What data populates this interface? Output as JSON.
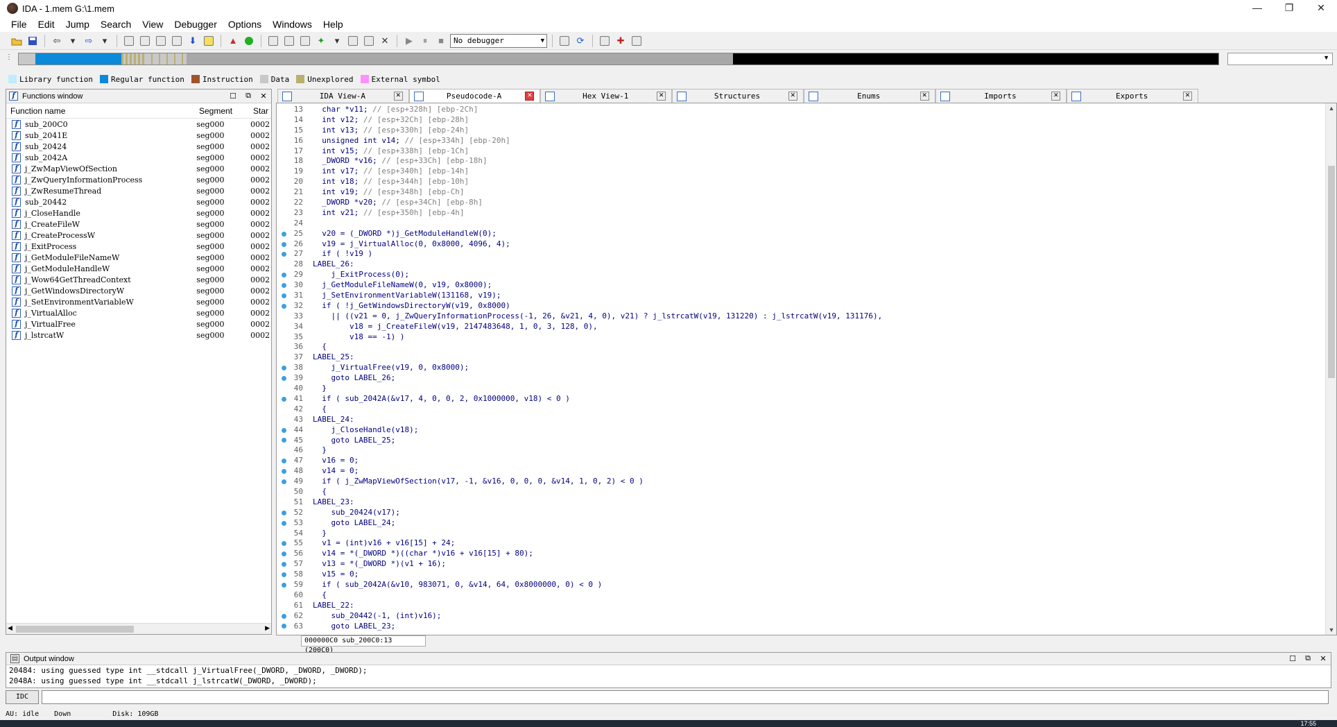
{
  "window": {
    "title": "IDA - 1.mem G:\\1.mem",
    "minimize": "—",
    "maximize": "❐",
    "close": "✕"
  },
  "menu": [
    "File",
    "Edit",
    "Jump",
    "Search",
    "View",
    "Debugger",
    "Options",
    "Windows",
    "Help"
  ],
  "toolbar": {
    "debugger_select": "No debugger"
  },
  "legend": [
    {
      "label": "Library function",
      "color": "#c0ecff"
    },
    {
      "label": "Regular function",
      "color": "#0a8ad8"
    },
    {
      "label": "Instruction",
      "color": "#a0522d"
    },
    {
      "label": "Data",
      "color": "#c8c8c8"
    },
    {
      "label": "Unexplored",
      "color": "#b8b070"
    },
    {
      "label": "External symbol",
      "color": "#ff90ff"
    }
  ],
  "functions_window": {
    "title": "Functions window",
    "columns": [
      "Function name",
      "Segment",
      "Star"
    ],
    "rows": [
      {
        "name": "sub_200C0",
        "segment": "seg000",
        "start": "0002"
      },
      {
        "name": "sub_2041E",
        "segment": "seg000",
        "start": "0002"
      },
      {
        "name": "sub_20424",
        "segment": "seg000",
        "start": "0002"
      },
      {
        "name": "sub_2042A",
        "segment": "seg000",
        "start": "0002"
      },
      {
        "name": "j_ZwMapViewOfSection",
        "segment": "seg000",
        "start": "0002"
      },
      {
        "name": "j_ZwQueryInformationProcess",
        "segment": "seg000",
        "start": "0002"
      },
      {
        "name": "j_ZwResumeThread",
        "segment": "seg000",
        "start": "0002"
      },
      {
        "name": "sub_20442",
        "segment": "seg000",
        "start": "0002"
      },
      {
        "name": "j_CloseHandle",
        "segment": "seg000",
        "start": "0002"
      },
      {
        "name": "j_CreateFileW",
        "segment": "seg000",
        "start": "0002"
      },
      {
        "name": "j_CreateProcessW",
        "segment": "seg000",
        "start": "0002"
      },
      {
        "name": "j_ExitProcess",
        "segment": "seg000",
        "start": "0002"
      },
      {
        "name": "j_GetModuleFileNameW",
        "segment": "seg000",
        "start": "0002"
      },
      {
        "name": "j_GetModuleHandleW",
        "segment": "seg000",
        "start": "0002"
      },
      {
        "name": "j_Wow64GetThreadContext",
        "segment": "seg000",
        "start": "0002"
      },
      {
        "name": "j_GetWindowsDirectoryW",
        "segment": "seg000",
        "start": "0002"
      },
      {
        "name": "j_SetEnvironmentVariableW",
        "segment": "seg000",
        "start": "0002"
      },
      {
        "name": "j_VirtualAlloc",
        "segment": "seg000",
        "start": "0002"
      },
      {
        "name": "j_VirtualFree",
        "segment": "seg000",
        "start": "0002"
      },
      {
        "name": "j_lstrcatW",
        "segment": "seg000",
        "start": "0002"
      }
    ]
  },
  "tabs": [
    {
      "label": "IDA View-A",
      "close": "✕",
      "active": false
    },
    {
      "label": "Pseudocode-A",
      "close": "✕",
      "active": true
    },
    {
      "label": "Hex View-1",
      "close": "✕",
      "active": false
    },
    {
      "label": "Structures",
      "close": "✕",
      "active": false
    },
    {
      "label": "Enums",
      "close": "✕",
      "active": false
    },
    {
      "label": "Imports",
      "close": "✕",
      "active": false
    },
    {
      "label": "Exports",
      "close": "✕",
      "active": false
    }
  ],
  "code": [
    {
      "n": "13",
      "dot": false,
      "code": "  char *v11; ",
      "comment": "// [esp+328h] [ebp-2Ch]"
    },
    {
      "n": "14",
      "dot": false,
      "code": "  int v12; ",
      "comment": "// [esp+32Ch] [ebp-28h]"
    },
    {
      "n": "15",
      "dot": false,
      "code": "  int v13; ",
      "comment": "// [esp+330h] [ebp-24h]"
    },
    {
      "n": "16",
      "dot": false,
      "code": "  unsigned int v14; ",
      "comment": "// [esp+334h] [ebp-20h]"
    },
    {
      "n": "17",
      "dot": false,
      "code": "  int v15; ",
      "comment": "// [esp+338h] [ebp-1Ch]"
    },
    {
      "n": "18",
      "dot": false,
      "code": "  _DWORD *v16; ",
      "comment": "// [esp+33Ch] [ebp-18h]"
    },
    {
      "n": "19",
      "dot": false,
      "code": "  int v17; ",
      "comment": "// [esp+340h] [ebp-14h]"
    },
    {
      "n": "20",
      "dot": false,
      "code": "  int v18; ",
      "comment": "// [esp+344h] [ebp-10h]"
    },
    {
      "n": "21",
      "dot": false,
      "code": "  int v19; ",
      "comment": "// [esp+348h] [ebp-Ch]"
    },
    {
      "n": "22",
      "dot": false,
      "code": "  _DWORD *v20; ",
      "comment": "// [esp+34Ch] [ebp-8h]"
    },
    {
      "n": "23",
      "dot": false,
      "code": "  int v21; ",
      "comment": "// [esp+350h] [ebp-4h]"
    },
    {
      "n": "24",
      "dot": false,
      "code": "",
      "comment": ""
    },
    {
      "n": "25",
      "dot": true,
      "code": "  v20 = (_DWORD *)j_GetModuleHandleW(0);",
      "comment": ""
    },
    {
      "n": "26",
      "dot": true,
      "code": "  v19 = j_VirtualAlloc(0, 0x8000, 4096, 4);",
      "comment": ""
    },
    {
      "n": "27",
      "dot": true,
      "code": "  if ( !v19 )",
      "comment": ""
    },
    {
      "n": "28",
      "dot": false,
      "code": "LABEL_26:",
      "comment": ""
    },
    {
      "n": "29",
      "dot": true,
      "code": "    j_ExitProcess(0);",
      "comment": ""
    },
    {
      "n": "30",
      "dot": true,
      "code": "  j_GetModuleFileNameW(0, v19, 0x8000);",
      "comment": ""
    },
    {
      "n": "31",
      "dot": true,
      "code": "  j_SetEnvironmentVariableW(131168, v19);",
      "comment": ""
    },
    {
      "n": "32",
      "dot": true,
      "code": "  if ( !j_GetWindowsDirectoryW(v19, 0x8000)",
      "comment": ""
    },
    {
      "n": "33",
      "dot": false,
      "code": "    || ((v21 = 0, j_ZwQueryInformationProcess(-1, 26, &v21, 4, 0), v21) ? j_lstrcatW(v19, 131220) : j_lstrcatW(v19, 131176),",
      "comment": ""
    },
    {
      "n": "34",
      "dot": false,
      "code": "        v18 = j_CreateFileW(v19, 2147483648, 1, 0, 3, 128, 0),",
      "comment": ""
    },
    {
      "n": "35",
      "dot": false,
      "code": "        v18 == -1) )",
      "comment": ""
    },
    {
      "n": "36",
      "dot": false,
      "code": "  {",
      "comment": ""
    },
    {
      "n": "37",
      "dot": false,
      "code": "LABEL_25:",
      "comment": ""
    },
    {
      "n": "38",
      "dot": true,
      "code": "    j_VirtualFree(v19, 0, 0x8000);",
      "comment": ""
    },
    {
      "n": "39",
      "dot": true,
      "code": "    goto LABEL_26;",
      "comment": ""
    },
    {
      "n": "40",
      "dot": false,
      "code": "  }",
      "comment": ""
    },
    {
      "n": "41",
      "dot": true,
      "code": "  if ( sub_2042A(&v17, 4, 0, 0, 2, 0x1000000, v18) < 0 )",
      "comment": ""
    },
    {
      "n": "42",
      "dot": false,
      "code": "  {",
      "comment": ""
    },
    {
      "n": "43",
      "dot": false,
      "code": "LABEL_24:",
      "comment": ""
    },
    {
      "n": "44",
      "dot": true,
      "code": "    j_CloseHandle(v18);",
      "comment": ""
    },
    {
      "n": "45",
      "dot": true,
      "code": "    goto LABEL_25;",
      "comment": ""
    },
    {
      "n": "46",
      "dot": false,
      "code": "  }",
      "comment": ""
    },
    {
      "n": "47",
      "dot": true,
      "code": "  v16 = 0;",
      "comment": ""
    },
    {
      "n": "48",
      "dot": true,
      "code": "  v14 = 0;",
      "comment": ""
    },
    {
      "n": "49",
      "dot": true,
      "code": "  if ( j_ZwMapViewOfSection(v17, -1, &v16, 0, 0, 0, &v14, 1, 0, 2) < 0 )",
      "comment": ""
    },
    {
      "n": "50",
      "dot": false,
      "code": "  {",
      "comment": ""
    },
    {
      "n": "51",
      "dot": false,
      "code": "LABEL_23:",
      "comment": ""
    },
    {
      "n": "52",
      "dot": true,
      "code": "    sub_20424(v17);",
      "comment": ""
    },
    {
      "n": "53",
      "dot": true,
      "code": "    goto LABEL_24;",
      "comment": ""
    },
    {
      "n": "54",
      "dot": false,
      "code": "  }",
      "comment": ""
    },
    {
      "n": "55",
      "dot": true,
      "code": "  v1 = (int)v16 + v16[15] + 24;",
      "comment": ""
    },
    {
      "n": "56",
      "dot": true,
      "code": "  v14 = *(_DWORD *)((char *)v16 + v16[15] + 80);",
      "comment": ""
    },
    {
      "n": "57",
      "dot": true,
      "code": "  v13 = *(_DWORD *)(v1 + 16);",
      "comment": ""
    },
    {
      "n": "58",
      "dot": true,
      "code": "  v15 = 0;",
      "comment": ""
    },
    {
      "n": "59",
      "dot": true,
      "code": "  if ( sub_2042A(&v10, 983071, 0, &v14, 64, 0x8000000, 0) < 0 )",
      "comment": ""
    },
    {
      "n": "60",
      "dot": false,
      "code": "  {",
      "comment": ""
    },
    {
      "n": "61",
      "dot": false,
      "code": "LABEL_22:",
      "comment": ""
    },
    {
      "n": "62",
      "dot": true,
      "code": "    sub_20442(-1, (int)v16);",
      "comment": ""
    },
    {
      "n": "63",
      "dot": true,
      "code": "    goto LABEL_23;",
      "comment": ""
    }
  ],
  "code_status": "000000C0 sub_200C0:13 (200C0)",
  "output_window": {
    "title": "Output window",
    "lines": [
      "20484: using guessed type int __stdcall j_VirtualFree(_DWORD, _DWORD, _DWORD);",
      "2048A: using guessed type int __stdcall j_lstrcatW(_DWORD, _DWORD);"
    ]
  },
  "command": {
    "button": "IDC"
  },
  "status": {
    "au_label": "AU:",
    "au_state": "idle",
    "direction": "Down",
    "disk": "Disk: 109GB"
  },
  "taskbar": {
    "clock": "17:55"
  }
}
